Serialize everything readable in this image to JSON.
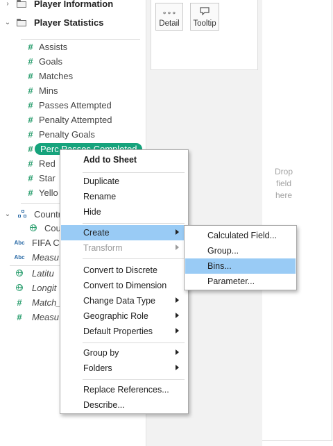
{
  "data_pane": {
    "folders": [
      {
        "label": "Player Information",
        "expanded": false
      },
      {
        "label": "Player Statistics",
        "expanded": true
      }
    ],
    "measures": [
      "Assists",
      "Goals",
      "Matches",
      "Mins",
      "Passes Attempted",
      "Penalty Attempted",
      "Penalty Goals",
      "Perc Passes Completed",
      "Red",
      "Star",
      "Yello"
    ],
    "hierarchy": {
      "label": "Countr",
      "child": "Cou"
    },
    "extra_fields": [
      {
        "icon": "abc",
        "label": "FIFA Co"
      },
      {
        "icon": "abc",
        "label": "Measu"
      },
      {
        "icon": "globe",
        "label": "Latitu"
      },
      {
        "icon": "globe",
        "label": "Longit"
      },
      {
        "icon": "hash",
        "label": "Match_"
      },
      {
        "icon": "hash",
        "label": "Measu"
      }
    ]
  },
  "marks": {
    "detail_label": "Detail",
    "tooltip_label": "Tooltip"
  },
  "view": {
    "drop_line1": "Drop",
    "drop_line2": "field",
    "drop_line3": "here"
  },
  "context_menu": {
    "add_to_sheet": "Add to Sheet",
    "duplicate": "Duplicate",
    "rename": "Rename",
    "hide": "Hide",
    "create": "Create",
    "transform": "Transform",
    "convert_discrete": "Convert to Discrete",
    "convert_dimension": "Convert to Dimension",
    "change_type": "Change Data Type",
    "geo_role": "Geographic Role",
    "default_props": "Default Properties",
    "group_by": "Group by",
    "folders": "Folders",
    "replace_refs": "Replace References...",
    "describe": "Describe..."
  },
  "create_submenu": {
    "calculated_field": "Calculated Field...",
    "group": "Group...",
    "bins": "Bins...",
    "parameter": "Parameter..."
  },
  "colors": {
    "pill_green": "#16a37c",
    "highlight_blue": "#99cbf5",
    "measure_green": "#2a9e6e",
    "dimension_blue": "#2a6aa6"
  }
}
